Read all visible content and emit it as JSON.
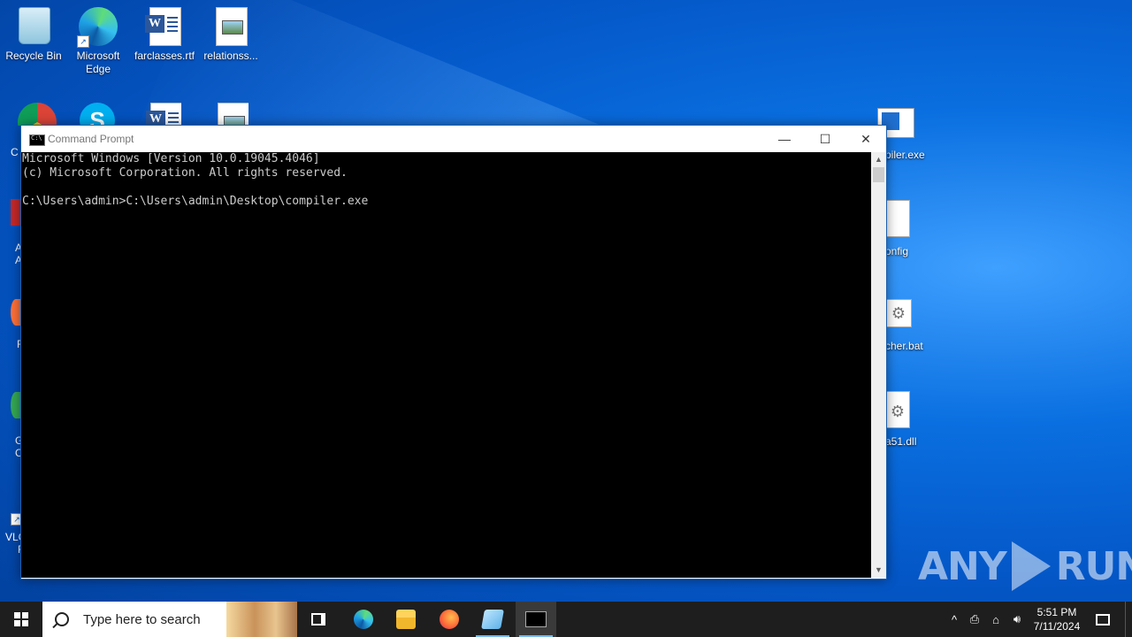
{
  "desktop": {
    "icons": [
      {
        "label": "Recycle Bin"
      },
      {
        "label": "Microsoft Edge"
      },
      {
        "label": "farclasses.rtf"
      },
      {
        "label": "relationss..."
      }
    ],
    "partial_labels": [
      "C",
      "A",
      "A",
      "F",
      "G",
      "C",
      "VLC",
      "F",
      "piler.exe",
      "onfig",
      "cher.bat",
      "a51.dll"
    ]
  },
  "cmd_window": {
    "title": "Command Prompt",
    "lines": [
      "Microsoft Windows [Version 10.0.19045.4046]",
      "(c) Microsoft Corporation. All rights reserved.",
      "",
      "C:\\Users\\admin>C:\\Users\\admin\\Desktop\\compiler.exe"
    ],
    "controls": {
      "minimize": "—",
      "maximize": "☐",
      "close": "✕"
    }
  },
  "watermark": {
    "left": "ANY",
    "right": "RUN"
  },
  "taskbar": {
    "search_placeholder": "Type here to search",
    "time": "5:51 PM",
    "date": "7/11/2024",
    "tray_chevron": "^"
  }
}
